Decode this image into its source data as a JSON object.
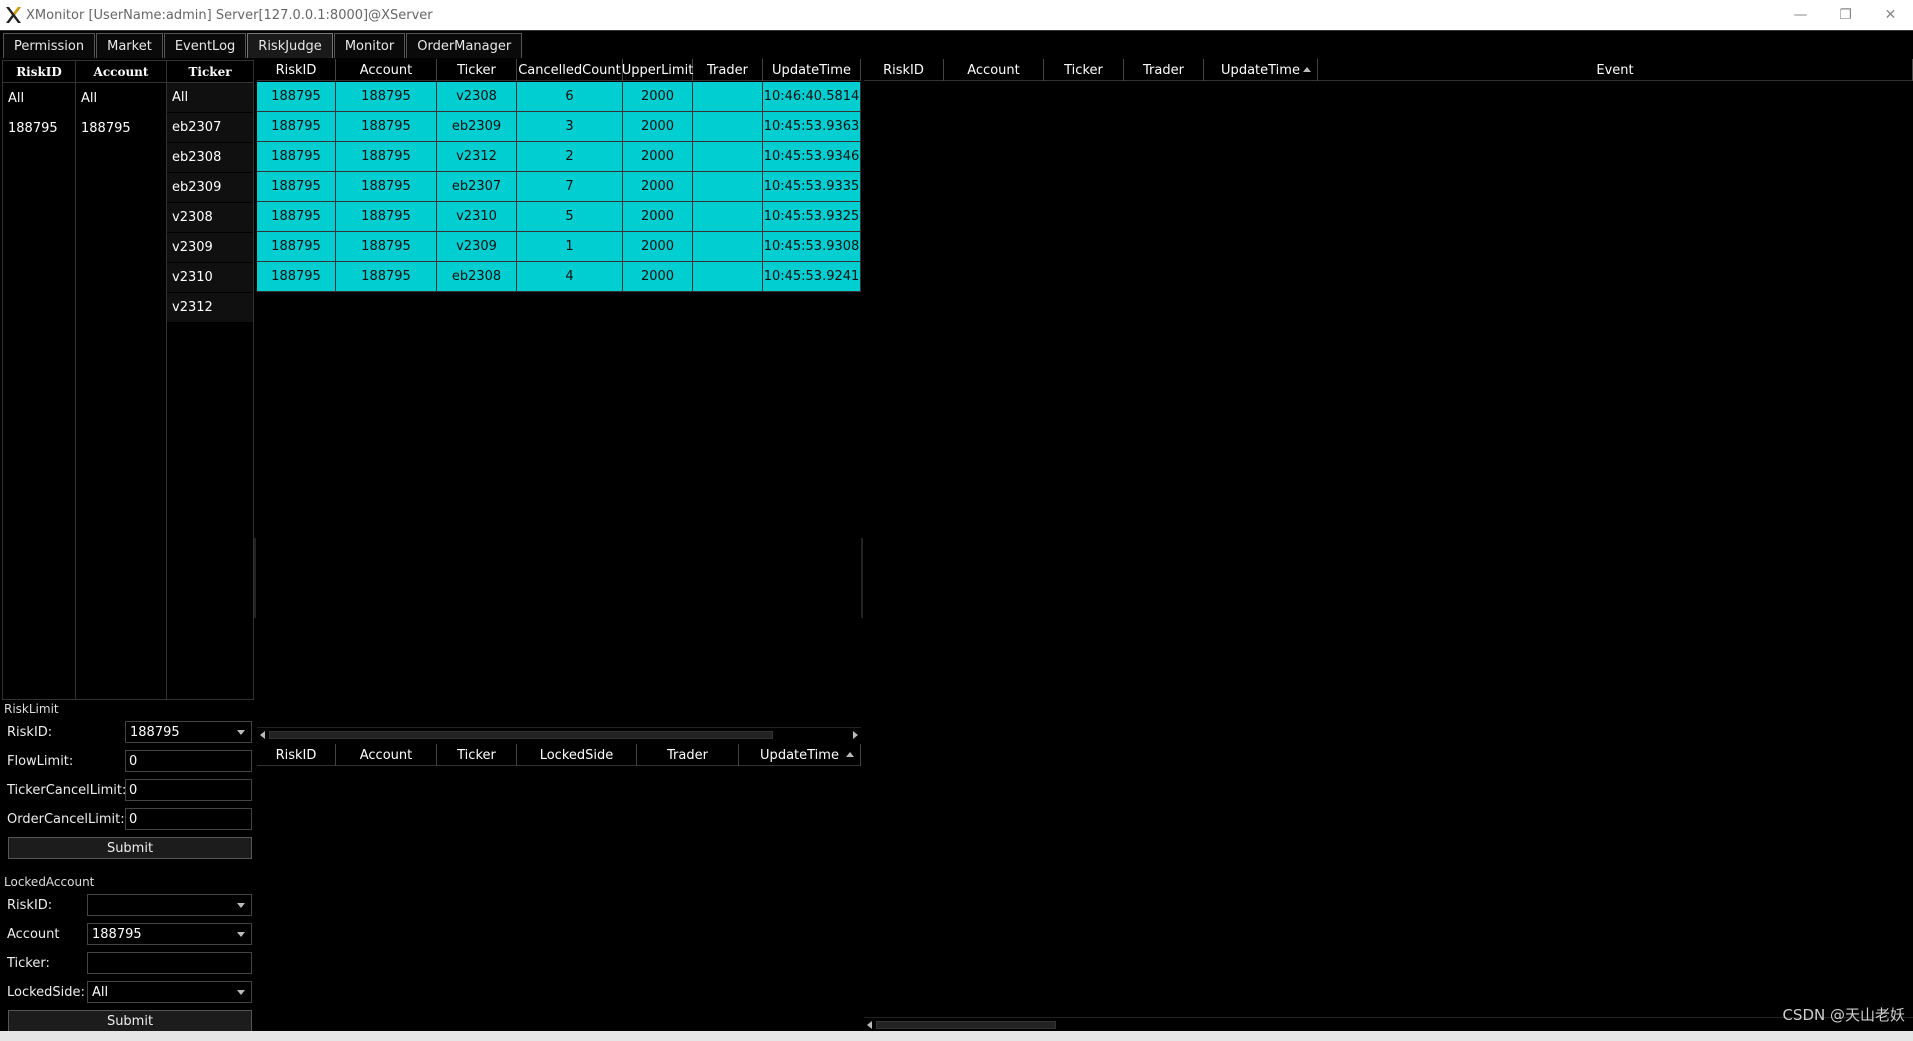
{
  "window": {
    "title": "XMonitor [UserName:admin] Server[127.0.0.1:8000]@XServer",
    "controls": {
      "minimize": "—",
      "restore": "❐",
      "close": "✕"
    }
  },
  "menu": {
    "tabs": [
      {
        "label": "Permission"
      },
      {
        "label": "Market"
      },
      {
        "label": "EventLog"
      },
      {
        "label": "RiskJudge"
      },
      {
        "label": "Monitor"
      },
      {
        "label": "OrderManager"
      }
    ],
    "active": "RiskJudge"
  },
  "filters": {
    "riskid": {
      "header": "RiskID",
      "items": [
        "All",
        "188795"
      ]
    },
    "account": {
      "header": "Account",
      "items": [
        "All",
        "188795"
      ]
    },
    "ticker": {
      "header": "Ticker",
      "items": [
        "All",
        "eb2307",
        "eb2308",
        "eb2309",
        "v2308",
        "v2309",
        "v2310",
        "v2312"
      ]
    }
  },
  "risk_limit": {
    "title": "RiskLimit",
    "riskid_label": "RiskID:",
    "riskid_value": "188795",
    "flow_label": "FlowLimit:",
    "flow_value": "0",
    "ticker_cancel_label": "TickerCancelLimit:",
    "ticker_cancel_value": "0",
    "order_cancel_label": "OrderCancelLimit:",
    "order_cancel_value": "0",
    "submit": "Submit"
  },
  "locked_account": {
    "title": "LockedAccount",
    "riskid_label": "RiskID:",
    "riskid_value": "",
    "account_label": "Account",
    "account_value": "188795",
    "ticker_label": "Ticker:",
    "ticker_value": "",
    "side_label": "LockedSide:",
    "side_value": "All",
    "submit": "Submit"
  },
  "cancel_table": {
    "columns": [
      "RiskID",
      "Account",
      "Ticker",
      "CancelledCount",
      "UpperLimit",
      "Trader",
      "UpdateTime"
    ],
    "rows": [
      [
        "188795",
        "188795",
        "v2308",
        "6",
        "2000",
        "",
        "10:46:40.5814"
      ],
      [
        "188795",
        "188795",
        "eb2309",
        "3",
        "2000",
        "",
        "10:45:53.9363"
      ],
      [
        "188795",
        "188795",
        "v2312",
        "2",
        "2000",
        "",
        "10:45:53.9346"
      ],
      [
        "188795",
        "188795",
        "eb2307",
        "7",
        "2000",
        "",
        "10:45:53.9335"
      ],
      [
        "188795",
        "188795",
        "v2310",
        "5",
        "2000",
        "",
        "10:45:53.9325"
      ],
      [
        "188795",
        "188795",
        "v2309",
        "1",
        "2000",
        "",
        "10:45:53.9308"
      ],
      [
        "188795",
        "188795",
        "eb2308",
        "4",
        "2000",
        "",
        "10:45:53.9241"
      ]
    ],
    "row_color": "#00ced1"
  },
  "locked_table": {
    "columns": [
      "RiskID",
      "Account",
      "Ticker",
      "LockedSide",
      "Trader",
      "UpdateTime"
    ]
  },
  "event_table": {
    "columns": [
      "RiskID",
      "Account",
      "Ticker",
      "Trader",
      "UpdateTime",
      "Event"
    ]
  },
  "watermark": "CSDN @天山老妖"
}
